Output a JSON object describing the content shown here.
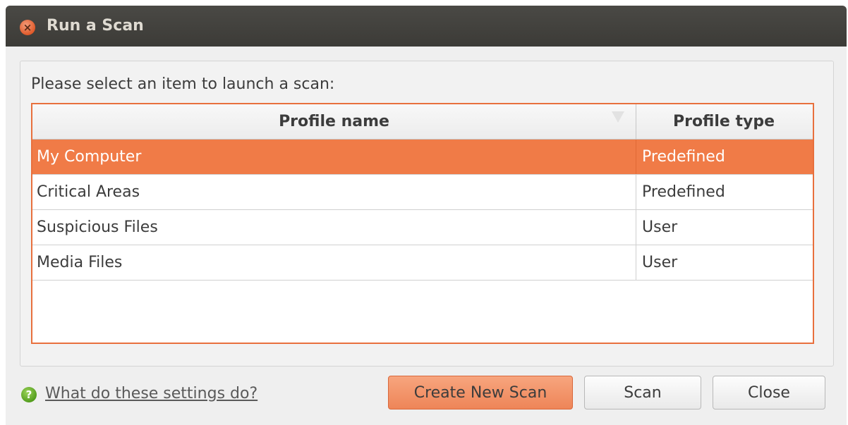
{
  "window": {
    "title": "Run a Scan",
    "close_icon": "close-icon",
    "close_glyph": "×"
  },
  "prompt": "Please select an item to launch a scan:",
  "table": {
    "columns": [
      "Profile name",
      "Profile type"
    ],
    "rows": [
      {
        "name": "My Computer",
        "type": "Predefined",
        "selected": true
      },
      {
        "name": "Critical Areas",
        "type": "Predefined",
        "selected": false
      },
      {
        "name": "Suspicious Files",
        "type": "User",
        "selected": false
      },
      {
        "name": "Media Files",
        "type": "User",
        "selected": false
      }
    ]
  },
  "footer": {
    "help_icon": "help-icon",
    "help_glyph": "?",
    "help_link": "What do these settings do?",
    "buttons": {
      "create": "Create New Scan",
      "scan": "Scan",
      "close": "Close"
    }
  },
  "colors": {
    "accent": "#f07b47",
    "titlebar": "#3c3b37"
  }
}
